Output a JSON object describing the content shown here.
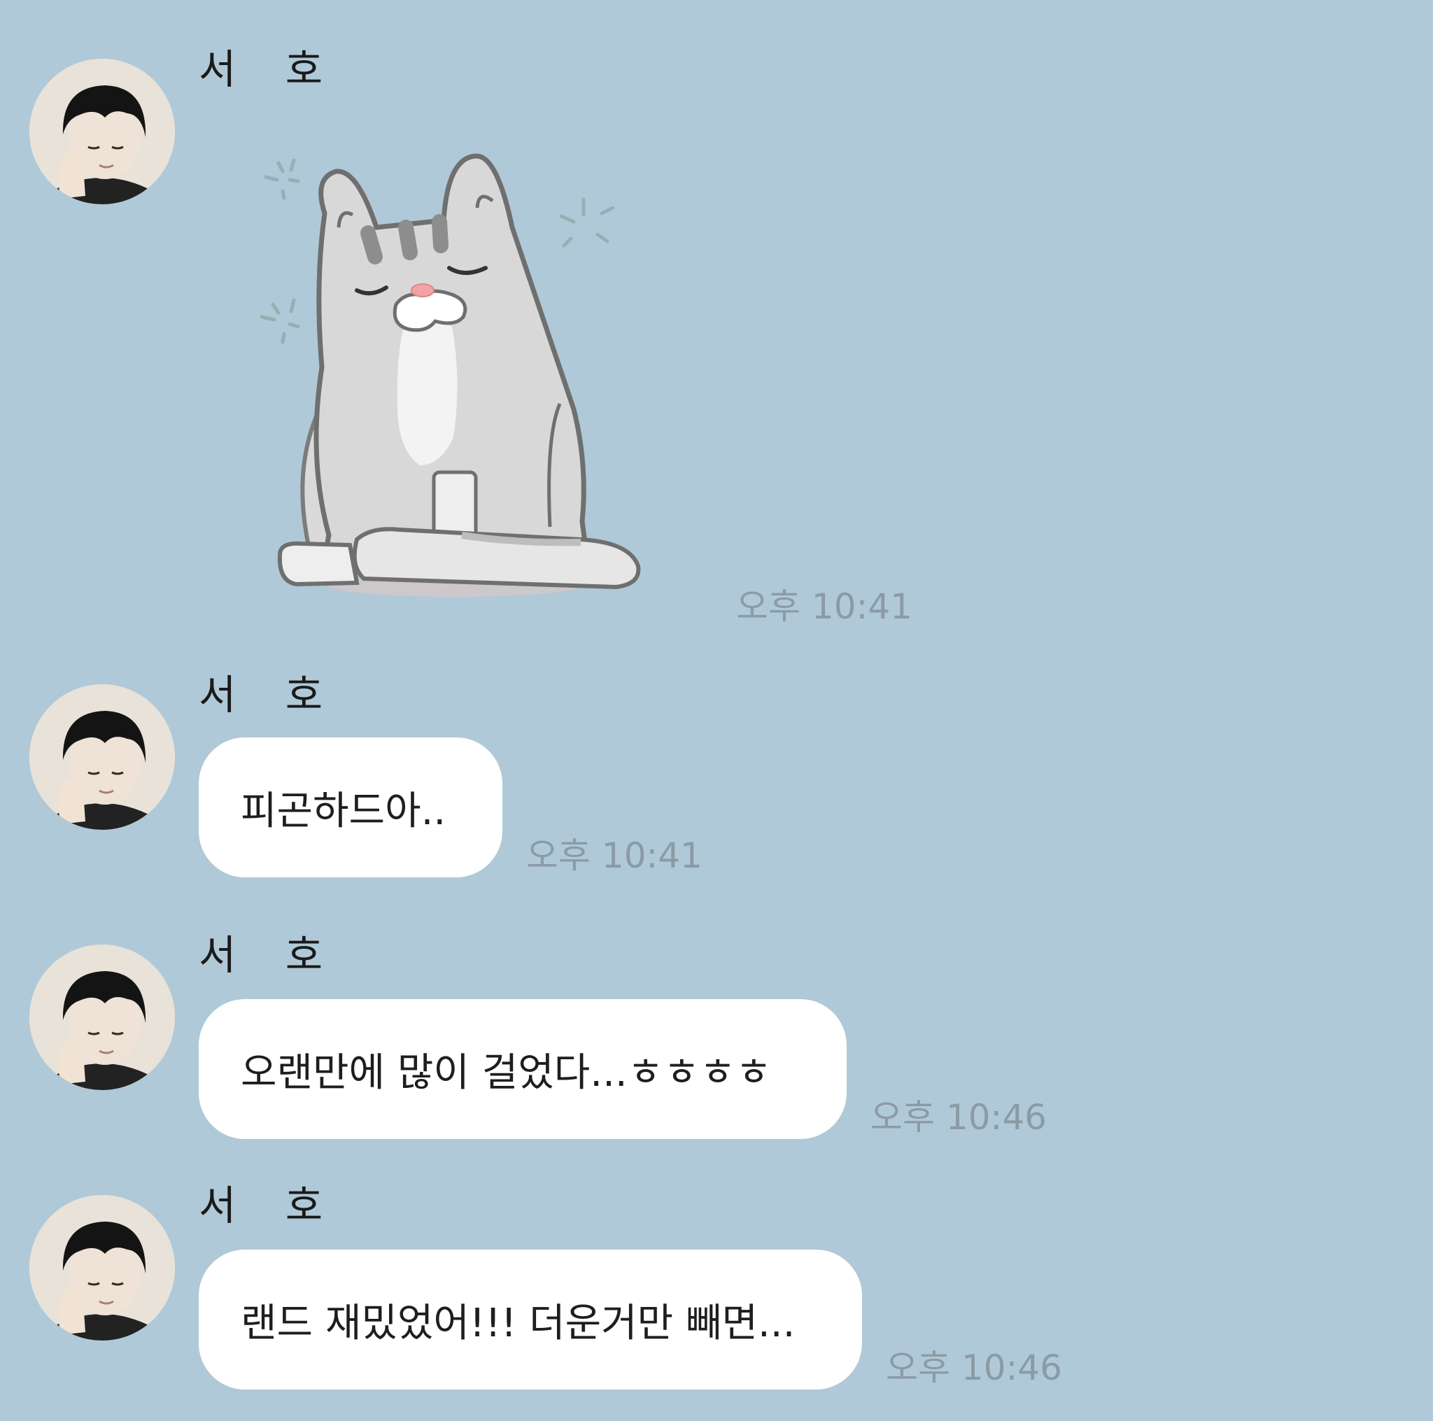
{
  "messages": [
    {
      "sender": "서 호",
      "type": "sticker",
      "sticker": "sleepy-gray-cat-sticker",
      "time": "오후 10:41"
    },
    {
      "sender": "서 호",
      "type": "text",
      "text": "피곤하드아..",
      "time": "오후 10:41"
    },
    {
      "sender": "서 호",
      "type": "text",
      "text": "오랜만에 많이 걸었다...ㅎㅎㅎㅎ",
      "time": "오후 10:46"
    },
    {
      "sender": "서 호",
      "type": "text",
      "text": "랜드 재밌었어!!! 더운거만 빼면...",
      "time": "오후 10:46"
    }
  ],
  "colors": {
    "background": "#b0c9d8",
    "bubble": "#ffffff",
    "timestamp": "#8b9ba6",
    "text": "#1e1e1e"
  }
}
